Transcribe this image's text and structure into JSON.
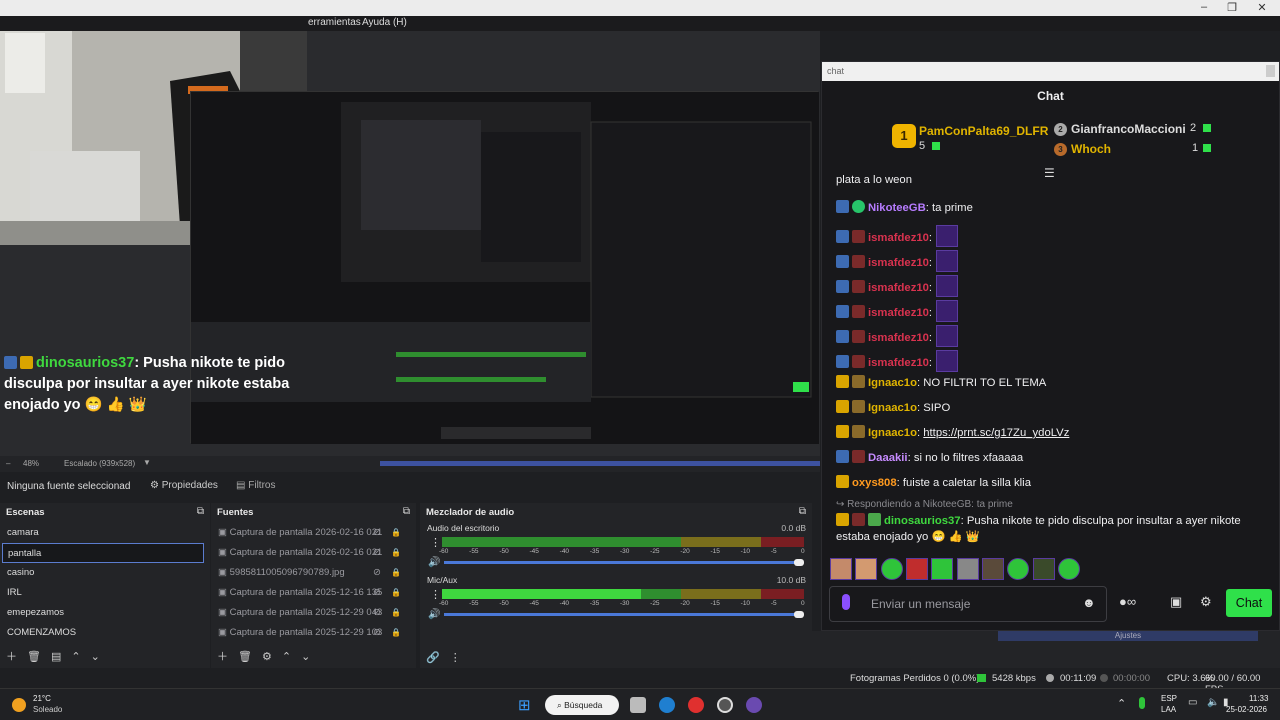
{
  "menubar": {
    "herramientas": "erramientas",
    "ayuda": "Ayuda (H)"
  },
  "preview": {
    "chat_overlay": {
      "user": "dinosaurios37",
      "text": ": Pusha nikote te pido disculpa por insultar a ayer nikote estaba enojado yo 😁 👍 👑"
    }
  },
  "zoom": {
    "percent": "48%",
    "scale_label": "Escalado (939x528)"
  },
  "props": {
    "no_source": "Ninguna fuente seleccionad",
    "properties": "Propiedades",
    "filters": "Filtros"
  },
  "scenes": {
    "title": "Escenas",
    "items": [
      "camara",
      "pantalla",
      "casino",
      "IRL",
      "emepezamos",
      "COMENZAMOS"
    ],
    "selected": 1
  },
  "sources": {
    "title": "Fuentes",
    "items": [
      "Captura de pantalla 2026-02-16 021",
      "Captura de pantalla 2026-02-16 021",
      "5985811005096790789.jpg",
      "Captura de pantalla 2025-12-16 135",
      "Captura de pantalla 2025-12-29 043",
      "Captura de pantalla 2025-12-29 103"
    ]
  },
  "mixer": {
    "title": "Mezclador de audio",
    "channels": [
      {
        "name": "Audio del escritorio",
        "db": "0.0 dB",
        "level": 0.0
      },
      {
        "name": "Mic/Aux",
        "db": "10.0 dB",
        "level": 0.55
      }
    ],
    "scale": [
      "-60",
      "-55",
      "-50",
      "-45",
      "-40",
      "-35",
      "-30",
      "-25",
      "-20",
      "-15",
      "-10",
      "-5",
      "0"
    ]
  },
  "chat": {
    "window_title": "chat",
    "header": "Chat",
    "leaderboard": {
      "first": {
        "name": "PamConPalta69_DLFR",
        "count": "5"
      },
      "second": {
        "name": "GianfrancoMaccioni",
        "count": "2"
      },
      "third": {
        "name": "Whoch",
        "count": "1"
      }
    },
    "partial_line": "plata a lo weon",
    "messages": [
      {
        "user": "NikoteeGB",
        "color": "#b77cff",
        "text": ": ta prime"
      },
      {
        "user": "ismafdez10",
        "color": "#d9324f",
        "text": ":"
      },
      {
        "user": "ismafdez10",
        "color": "#d9324f",
        "text": ":"
      },
      {
        "user": "ismafdez10",
        "color": "#d9324f",
        "text": ":"
      },
      {
        "user": "ismafdez10",
        "color": "#d9324f",
        "text": ":"
      },
      {
        "user": "ismafdez10",
        "color": "#d9324f",
        "text": ":"
      },
      {
        "user": "ismafdez10",
        "color": "#d9324f",
        "text": ":"
      },
      {
        "user": "Ignaac1o",
        "color": "#e0b400",
        "text": ": NO FILTRI TO EL TEMA"
      },
      {
        "user": "Ignaac1o",
        "color": "#e0b400",
        "text": ": SIPO"
      },
      {
        "user": "Ignaac1o",
        "color": "#e0b400",
        "text": ": ",
        "link": "https://prnt.sc/g17Zu_ydoLVz"
      },
      {
        "user": "Daaakii",
        "color": "#c68bff",
        "text": ": si no lo filtres xfaaaaa"
      },
      {
        "user": "oxys808",
        "color": "#ff9a1f",
        "text": ": fuiste a caletar la silla klia"
      }
    ],
    "reply_to": "Respondiendo a NikoteeGB: ta prime",
    "last": {
      "user": "dinosaurios37",
      "text": ": Pusha nikote te pido disculpa por insultar a ayer nikote",
      "text2": "estaba enojado yo 😁 👍 👑"
    },
    "input_placeholder": "Enviar un mensaje",
    "send_label": "Chat"
  },
  "obs_status": {
    "dropped": "Fotogramas Perdidos 0 (0.0%)",
    "bitrate": "5428 kbps",
    "stream_time": "00:11:09",
    "rec_time": "00:00:00",
    "cpu": "CPU: 3.6%",
    "fps": "60.00 / 60.00 FPS"
  },
  "taskbar": {
    "weather_temp": "21°C",
    "weather_desc": "Soleado",
    "search": "Búsqueda",
    "lang1": "ESP",
    "lang2": "LAA",
    "time": "11:33",
    "date": "25-02-2026"
  },
  "behind_chat": {
    "settings": "Ajustes"
  }
}
